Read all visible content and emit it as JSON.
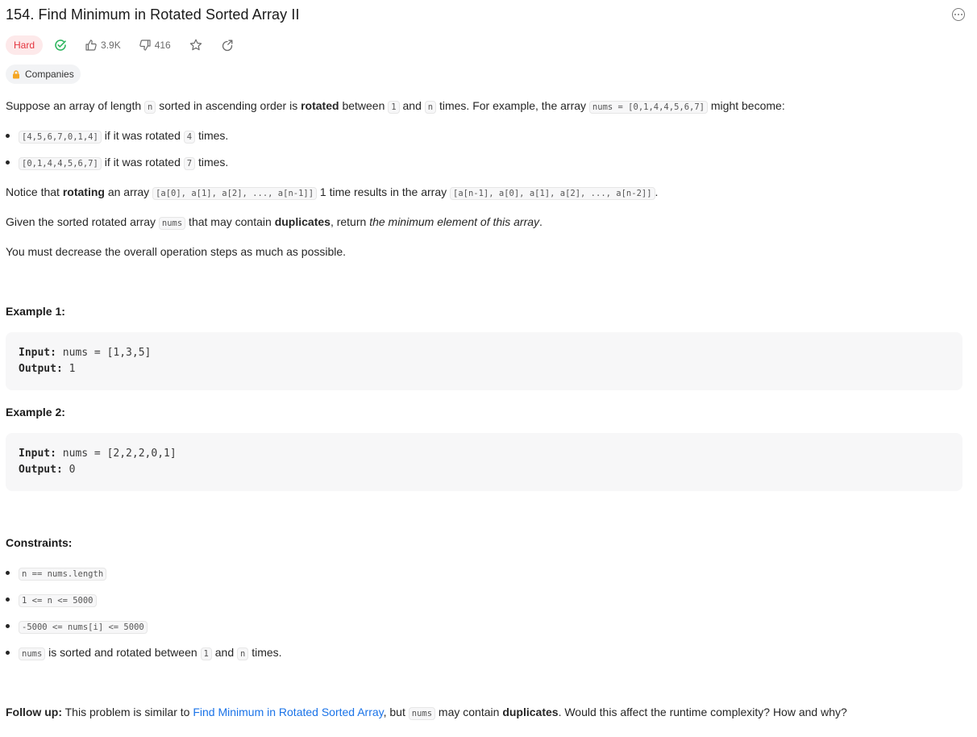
{
  "problem": {
    "title": "154. Find Minimum in Rotated Sorted Array II",
    "difficulty": "Hard",
    "likes": "3.9K",
    "dislikes": "416",
    "companies_label": "Companies"
  },
  "description": {
    "p1": {
      "t1": "Suppose an array of length ",
      "c1": "n",
      "t2": " sorted in ascending order is ",
      "b1": "rotated",
      "t3": " between ",
      "c2": "1",
      "t4": " and ",
      "c3": "n",
      "t5": " times. For example, the array ",
      "c4": "nums = [0,1,4,4,5,6,7]",
      "t6": " might become:"
    },
    "bullets": [
      {
        "code": "[4,5,6,7,0,1,4]",
        "t1": " if it was rotated ",
        "code2": "4",
        "t2": " times."
      },
      {
        "code": "[0,1,4,4,5,6,7]",
        "t1": " if it was rotated ",
        "code2": "7",
        "t2": " times."
      }
    ],
    "p2": {
      "t1": "Notice that ",
      "b1": "rotating",
      "t2": " an array ",
      "c1": "[a[0], a[1], a[2], ..., a[n-1]]",
      "t3": " 1 time results in the array ",
      "c2": "[a[n-1], a[0], a[1], a[2], ..., a[n-2]]",
      "t4": "."
    },
    "p3": {
      "t1": "Given the sorted rotated array ",
      "c1": "nums",
      "t2": " that may contain ",
      "b1": "duplicates",
      "t3": ", return ",
      "i1": "the minimum element of this array",
      "t4": "."
    },
    "p4": "You must decrease the overall operation steps as much as possible."
  },
  "examples": [
    {
      "heading": "Example 1:",
      "input_label": "Input:",
      "input": " nums = [1,3,5]",
      "output_label": "Output:",
      "output": " 1"
    },
    {
      "heading": "Example 2:",
      "input_label": "Input:",
      "input": " nums = [2,2,2,0,1]",
      "output_label": "Output:",
      "output": " 0"
    }
  ],
  "constraints": {
    "heading": "Constraints:",
    "items": [
      "n == nums.length",
      "1 <= n <= 5000",
      "-5000 <= nums[i] <= 5000"
    ],
    "last": {
      "c1": "nums",
      "t1": " is sorted and rotated between ",
      "c2": "1",
      "t2": " and ",
      "c3": "n",
      "t3": " times."
    }
  },
  "follow_up": {
    "label": "Follow up:",
    "t1": " This problem is similar to ",
    "link": "Find Minimum in Rotated Sorted Array",
    "t2": ", but ",
    "c1": "nums",
    "t3": " may contain ",
    "b1": "duplicates",
    "t4": ". Would this affect the runtime complexity? How and why?"
  },
  "colors": {
    "hard_text": "#e4343e",
    "hard_bg": "#fde9ea",
    "solved_green": "#2db55d",
    "link_blue": "#1a73e8",
    "lock_orange": "#f5a623"
  },
  "icons": [
    "solved-check-icon",
    "thumbs-up-icon",
    "thumbs-down-icon",
    "star-icon",
    "share-icon",
    "lock-icon",
    "more-icon"
  ]
}
